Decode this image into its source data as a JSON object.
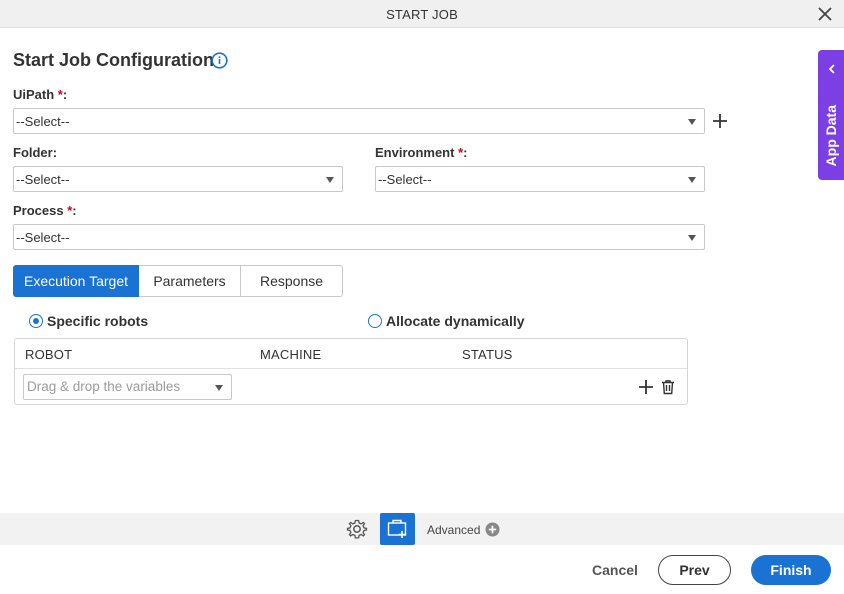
{
  "window": {
    "title": "START JOB"
  },
  "page": {
    "heading": "Start Job Configuration"
  },
  "fields": {
    "uipath": {
      "label": "UiPath",
      "required_mark": "*",
      "colon": ":",
      "value": "--Select--"
    },
    "folder": {
      "label": "Folder:",
      "value": "--Select--"
    },
    "environment": {
      "label": "Environment",
      "required_mark": "*",
      "colon": ":",
      "value": "--Select--"
    },
    "process": {
      "label": "Process",
      "required_mark": "*",
      "colon": ":",
      "value": "--Select--"
    }
  },
  "tabs": [
    {
      "label": "Execution Target",
      "active": true
    },
    {
      "label": "Parameters",
      "active": false
    },
    {
      "label": "Response",
      "active": false
    }
  ],
  "execution_target": {
    "options": [
      {
        "label": "Specific robots",
        "checked": true
      },
      {
        "label": "Allocate dynamically",
        "checked": false
      }
    ],
    "columns": [
      "ROBOT",
      "MACHINE",
      "STATUS"
    ],
    "robot_placeholder": "Drag & drop the variables"
  },
  "side_panel": {
    "label": "App Data"
  },
  "toolbar": {
    "advanced_label": "Advanced"
  },
  "footer": {
    "cancel": "Cancel",
    "prev": "Prev",
    "finish": "Finish"
  },
  "colors": {
    "accent": "#1a73d2",
    "side_tab": "#7b3fe4",
    "required": "#d0021b"
  },
  "icons": {
    "close": "close-icon",
    "info": "info-icon",
    "add": "plus-icon",
    "delete": "trash-icon",
    "settings": "gear-icon",
    "app_data_chevron": "chevron-left-icon",
    "advanced": "plus-circle-icon",
    "app_btn": "screen-add-icon"
  }
}
